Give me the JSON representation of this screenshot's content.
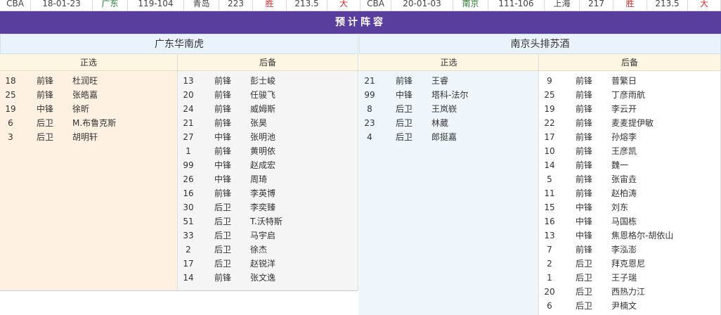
{
  "top_row": [
    {
      "cells": [
        {
          "text": "CBA",
          "color": "normal",
          "w": 44
        },
        {
          "text": "18-01-23",
          "color": "normal",
          "w": 88
        },
        {
          "text": "广东",
          "color": "green",
          "w": 50
        },
        {
          "text": "119-104",
          "color": "normal",
          "w": 80
        },
        {
          "text": "青岛",
          "color": "normal",
          "w": 50
        },
        {
          "text": "223",
          "color": "normal",
          "w": 48
        },
        {
          "text": "胜",
          "color": "red",
          "w": 48
        },
        {
          "text": "213.5",
          "color": "normal",
          "w": 58
        },
        {
          "text": "大",
          "color": "red",
          "w": 47
        }
      ]
    },
    {
      "cells": [
        {
          "text": "CBA",
          "color": "normal",
          "w": 44
        },
        {
          "text": "20-01-03",
          "color": "normal",
          "w": 88
        },
        {
          "text": "南京",
          "color": "green",
          "w": 50
        },
        {
          "text": "111-106",
          "color": "normal",
          "w": 80
        },
        {
          "text": "上海",
          "color": "normal",
          "w": 50
        },
        {
          "text": "217",
          "color": "normal",
          "w": 48
        },
        {
          "text": "胜",
          "color": "red",
          "w": 48
        },
        {
          "text": "213.5",
          "color": "normal",
          "w": 58
        },
        {
          "text": "大",
          "color": "red",
          "w": 47
        }
      ]
    }
  ],
  "section_title": "预计阵容",
  "teams": [
    {
      "name": "广东华南虎",
      "starters_label": "正选",
      "bench_label": "后备",
      "starters": [
        {
          "num": "18",
          "pos": "前锋",
          "name": "杜润旺"
        },
        {
          "num": "25",
          "pos": "前锋",
          "name": "张皓嘉"
        },
        {
          "num": "19",
          "pos": "中锋",
          "name": "徐昕"
        },
        {
          "num": "6",
          "pos": "后卫",
          "name": "M.布鲁克斯"
        },
        {
          "num": "3",
          "pos": "后卫",
          "name": "胡明轩"
        }
      ],
      "bench": [
        {
          "num": "13",
          "pos": "前锋",
          "name": "彭士峻"
        },
        {
          "num": "20",
          "pos": "前锋",
          "name": "任骏飞"
        },
        {
          "num": "24",
          "pos": "前锋",
          "name": "威姆斯"
        },
        {
          "num": "21",
          "pos": "前锋",
          "name": "张昊"
        },
        {
          "num": "27",
          "pos": "中锋",
          "name": "张明池"
        },
        {
          "num": "1",
          "pos": "前锋",
          "name": "黄明依"
        },
        {
          "num": "99",
          "pos": "中锋",
          "name": "赵成宏"
        },
        {
          "num": "26",
          "pos": "中锋",
          "name": "周琦"
        },
        {
          "num": "16",
          "pos": "前锋",
          "name": "李英博"
        },
        {
          "num": "30",
          "pos": "后卫",
          "name": "李奕臻"
        },
        {
          "num": "51",
          "pos": "后卫",
          "name": "T.沃特斯"
        },
        {
          "num": "33",
          "pos": "后卫",
          "name": "马宇启"
        },
        {
          "num": "2",
          "pos": "后卫",
          "name": "徐杰"
        },
        {
          "num": "17",
          "pos": "后卫",
          "name": "赵锐洋"
        },
        {
          "num": "14",
          "pos": "前锋",
          "name": "张文逸"
        }
      ]
    },
    {
      "name": "南京头排苏酒",
      "starters_label": "正选",
      "bench_label": "后备",
      "starters": [
        {
          "num": "21",
          "pos": "前锋",
          "name": "王睿"
        },
        {
          "num": "99",
          "pos": "中锋",
          "name": "塔科-法尔"
        },
        {
          "num": "8",
          "pos": "后卫",
          "name": "王岚嵚"
        },
        {
          "num": "23",
          "pos": "后卫",
          "name": "林葳"
        },
        {
          "num": "4",
          "pos": "后卫",
          "name": "郎挺嘉"
        }
      ],
      "bench": [
        {
          "num": "9",
          "pos": "前锋",
          "name": "普繁日"
        },
        {
          "num": "25",
          "pos": "前锋",
          "name": "丁彦雨航"
        },
        {
          "num": "19",
          "pos": "前锋",
          "name": "李云开"
        },
        {
          "num": "22",
          "pos": "前锋",
          "name": "麦麦提伊敏"
        },
        {
          "num": "17",
          "pos": "前锋",
          "name": "孙熔李"
        },
        {
          "num": "10",
          "pos": "前锋",
          "name": "王彦凯"
        },
        {
          "num": "14",
          "pos": "前锋",
          "name": "魏一"
        },
        {
          "num": "5",
          "pos": "前锋",
          "name": "张宙垚"
        },
        {
          "num": "11",
          "pos": "前锋",
          "name": "赵柏涛"
        },
        {
          "num": "15",
          "pos": "中锋",
          "name": "刘东"
        },
        {
          "num": "16",
          "pos": "中锋",
          "name": "马国栋"
        },
        {
          "num": "13",
          "pos": "中锋",
          "name": "焦恩格尔-胡依山"
        },
        {
          "num": "7",
          "pos": "前锋",
          "name": "李泓澎"
        },
        {
          "num": "2",
          "pos": "后卫",
          "name": "拜克恩尼"
        },
        {
          "num": "1",
          "pos": "后卫",
          "name": "王子瑞"
        },
        {
          "num": "20",
          "pos": "后卫",
          "name": "西热力江"
        },
        {
          "num": "6",
          "pos": "后卫",
          "name": "尹楠文"
        }
      ]
    }
  ]
}
